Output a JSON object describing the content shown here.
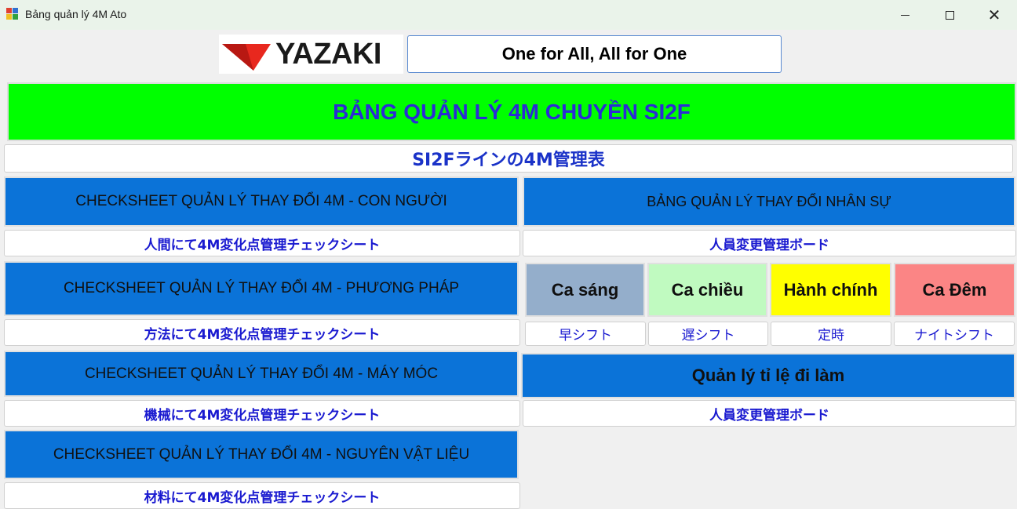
{
  "window": {
    "title": "Bảng quản lý 4M Ato",
    "close_glyph": "✕"
  },
  "header": {
    "logo_text": "YAZAKI",
    "slogan": "One for All, All for One"
  },
  "main_title": "BẢNG QUẢN LÝ 4M CHUYỀN SI2F",
  "jp_title": "SI2Fラインの4M管理表",
  "checksheets": [
    {
      "label": "CHECKSHEET QUẢN LÝ THAY ĐỔI 4M - CON NGƯỜI",
      "jp": "人間にて4M変化点管理チェックシート"
    },
    {
      "label": "CHECKSHEET QUẢN LÝ THAY ĐỔI 4M - PHƯƠNG PHÁP",
      "jp": "方法にて4M変化点管理チェックシート"
    },
    {
      "label": "CHECKSHEET QUẢN LÝ THAY ĐỔI 4M - MÁY MÓC",
      "jp": "機械にて4M変化点管理チェックシート"
    },
    {
      "label": "CHECKSHEET QUẢN LÝ THAY ĐỔI 4M - NGUYÊN VẬT LIỆU",
      "jp": "材料にて4M変化点管理チェックシート"
    }
  ],
  "personnel_board": {
    "label": "BẢNG QUẢN LÝ THAY ĐỔI NHÂN SỰ",
    "jp": "人員変更管理ボード"
  },
  "shifts": [
    {
      "label": "Ca sáng",
      "jp": "早シフト",
      "color": "#94aecb"
    },
    {
      "label": "Ca chiều",
      "jp": "遅シフト",
      "color": "#c0fac0"
    },
    {
      "label": "Hành chính",
      "jp": "定時",
      "color": "#ffff00"
    },
    {
      "label": "Ca Đêm",
      "jp": "ナイトシフト",
      "color": "#fb8585"
    }
  ],
  "attendance": {
    "label": "Quản lý tỉ lệ đi làm",
    "jp": "人員変更管理ボード"
  },
  "colors": {
    "accent_blue": "#0b73d8",
    "title_green": "#00ff00",
    "title_text": "#2b2bd6",
    "label_text": "#1a1ad0",
    "logo_red": "#e8281e"
  }
}
